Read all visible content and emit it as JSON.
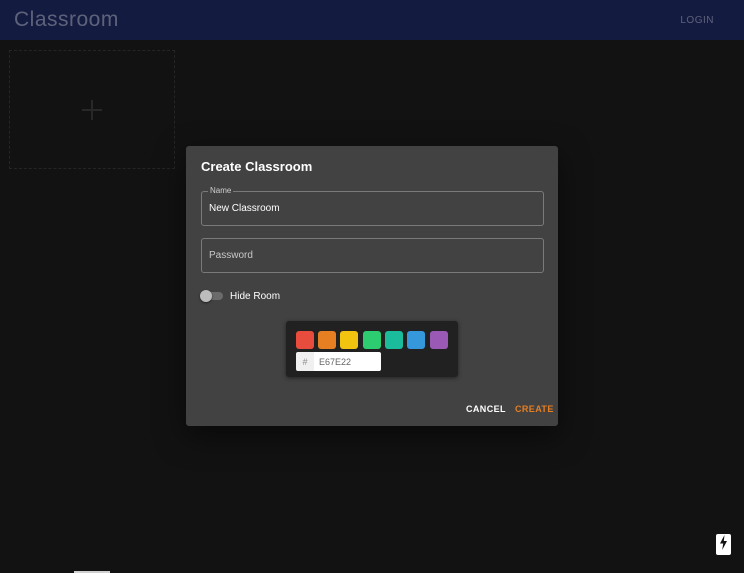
{
  "app": {
    "title": "Classroom",
    "login_label": "LOGIN"
  },
  "dialog": {
    "title": "Create Classroom",
    "name_field": {
      "label": "Name",
      "value": "New Classroom"
    },
    "password_field": {
      "placeholder": "Password",
      "value": ""
    },
    "hide_room": {
      "label": "Hide Room",
      "checked": false
    },
    "color_picker": {
      "swatches": [
        "#E74C3C",
        "#E67E22",
        "#F1C40F",
        "#2ECC71",
        "#1ABC9C",
        "#3498DB",
        "#9B59B6"
      ],
      "hex_prefix": "#",
      "hex_value": "E67E22"
    },
    "cancel_label": "CANCEL",
    "create_label": "CREATE"
  },
  "colors": {
    "appbar": "#1F2A63",
    "background": "#1C1C1C",
    "dialog": "#424242",
    "accent": "#E67E22"
  },
  "icons": {
    "add": "plus-icon",
    "fab": "lightning-bolt-icon"
  }
}
